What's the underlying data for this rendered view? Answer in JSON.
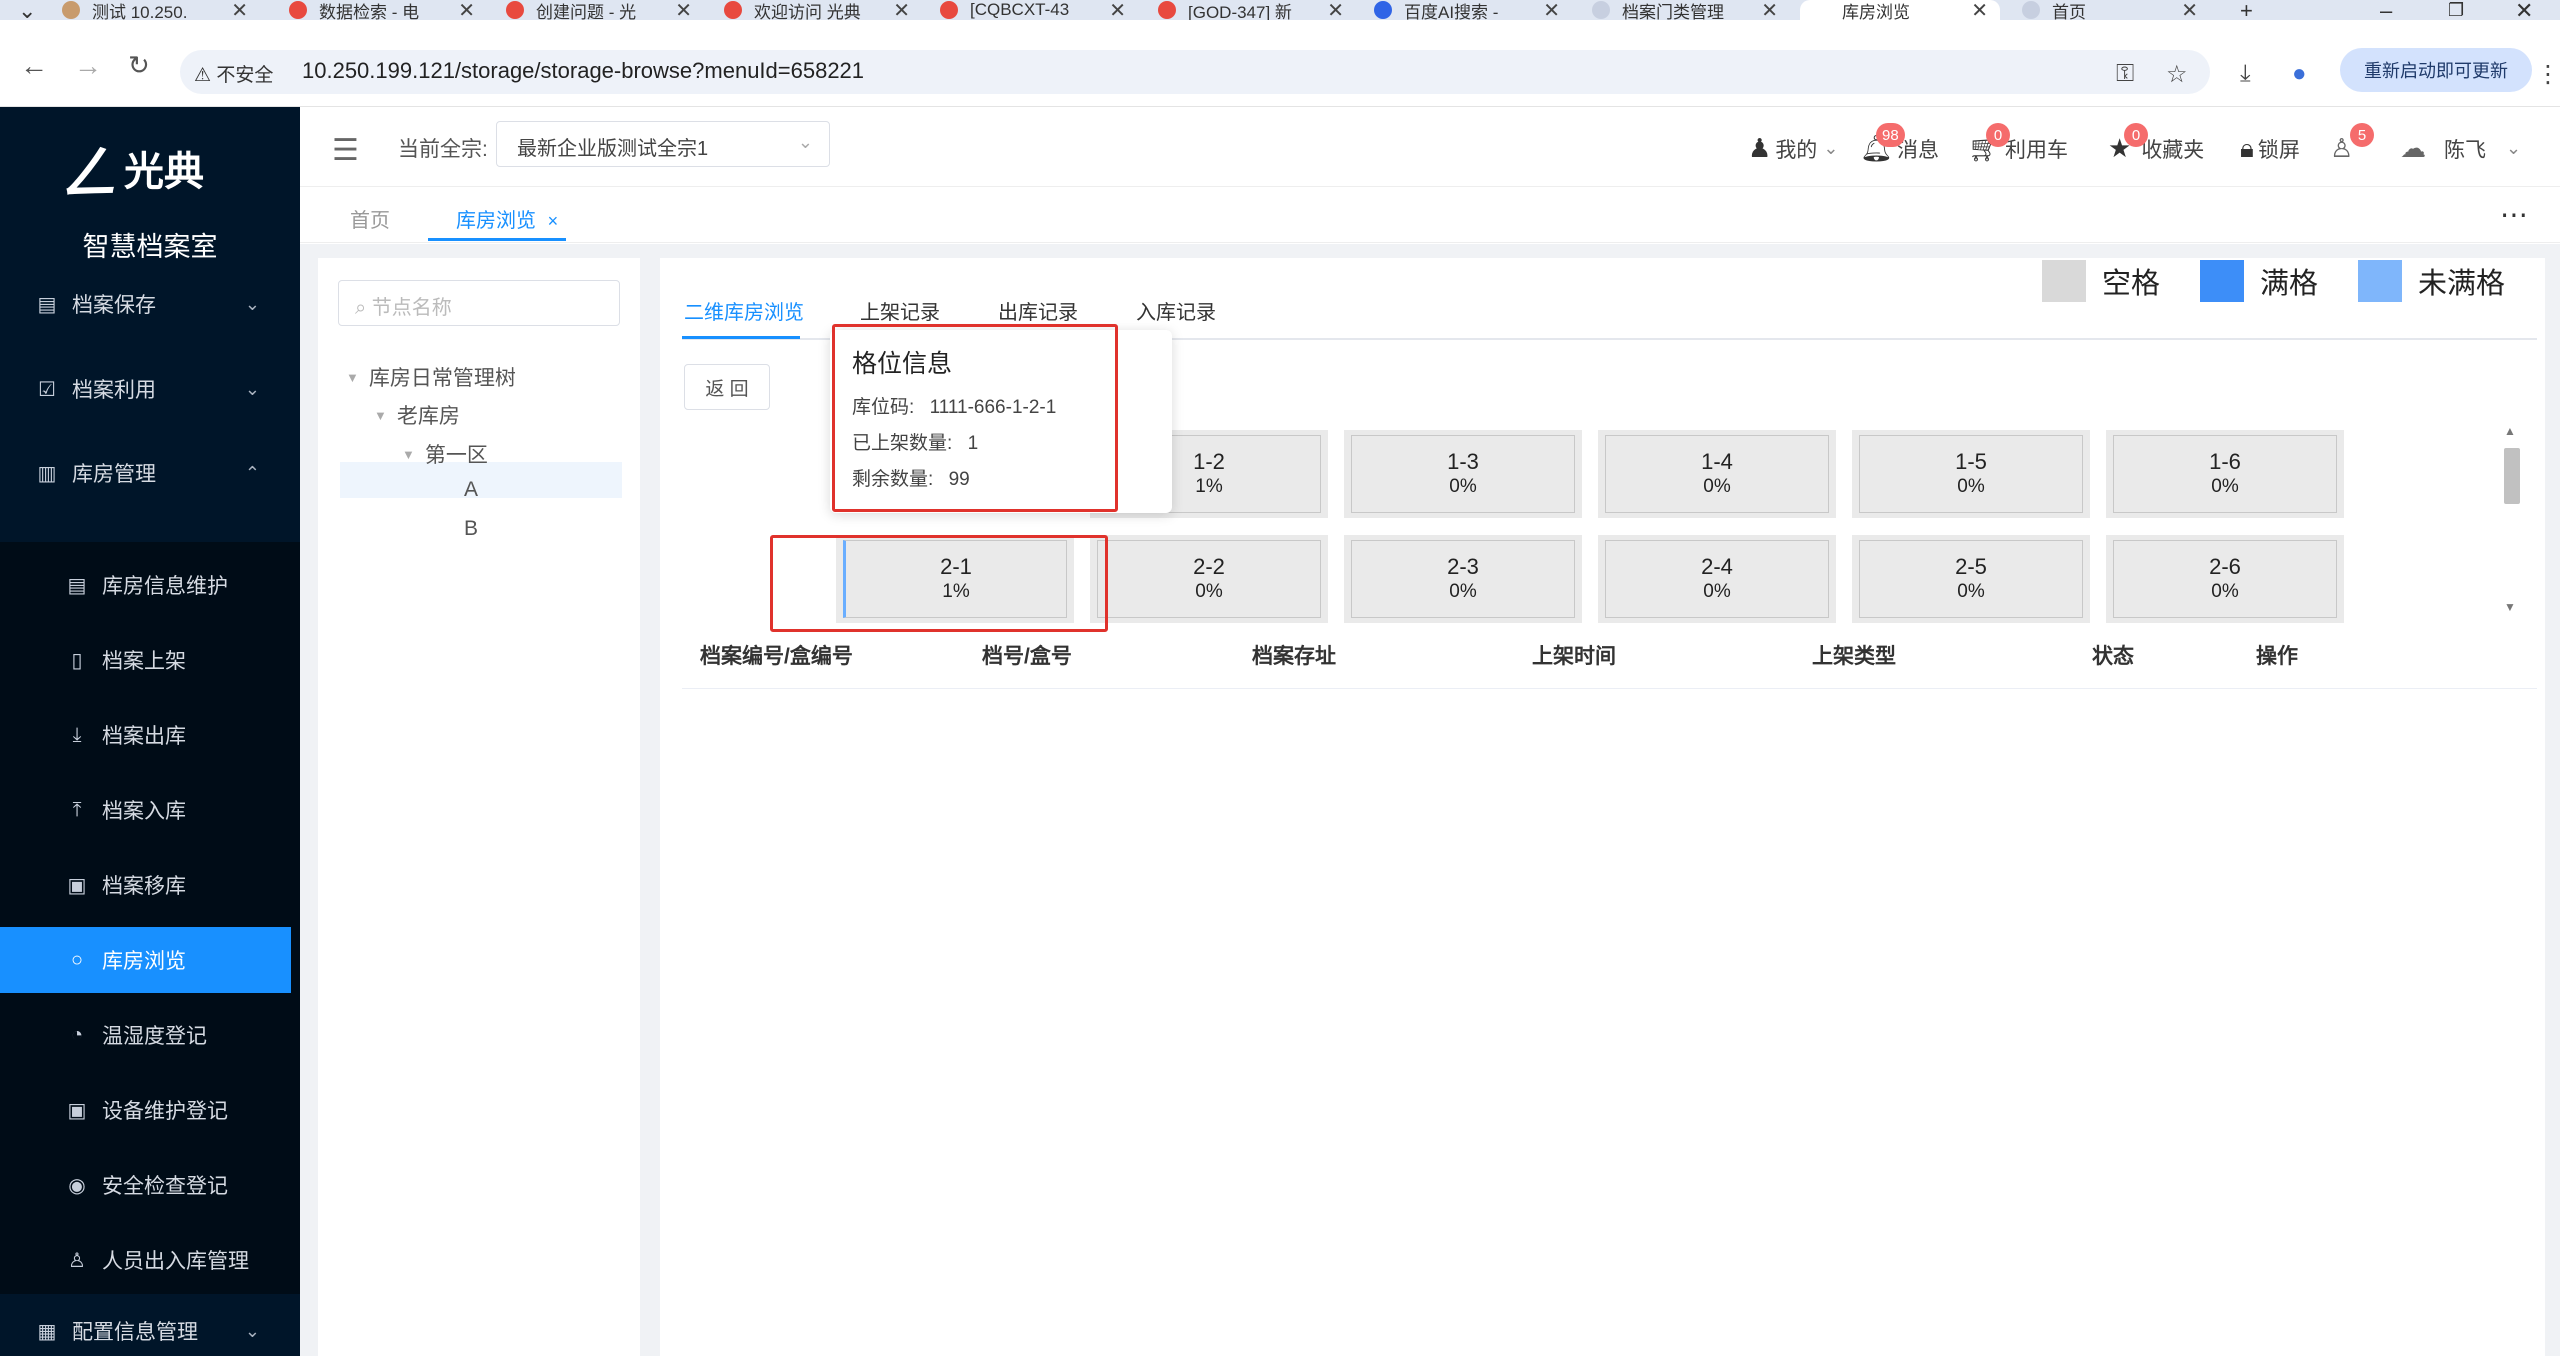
{
  "browser": {
    "tabs": [
      {
        "title": "测试 10.250.",
        "icon_color": "#c89b6d"
      },
      {
        "title": "数据检索 - 电",
        "icon_color": "#e8493f"
      },
      {
        "title": "创建问题 - 光",
        "icon_color": "#e8493f"
      },
      {
        "title": "欢迎访问 光典",
        "icon_color": "#e8493f"
      },
      {
        "title": "[CQBCXT-43",
        "icon_color": "#e8493f"
      },
      {
        "title": "[GOD-347] 新",
        "icon_color": "#e8493f"
      },
      {
        "title": "百度AI搜索 -",
        "icon_color": "#3064e6"
      },
      {
        "title": "档案门类管理",
        "icon_color": "#c7cfe0"
      },
      {
        "title": "库房浏览",
        "icon_color": "#ffffff"
      },
      {
        "title": "首页",
        "icon_color": "#c7cfe0"
      }
    ],
    "security_label": "不安全",
    "url": "10.250.199.121/storage/storage-browse?menuId=658221",
    "restart_label": "重新启动即可更新"
  },
  "sidebar": {
    "logo_text": "光典",
    "app_name": "智慧档案室",
    "items": [
      {
        "label": "档案保存",
        "icon": "building-icon",
        "glyph": "▤",
        "arrow": "⌄"
      },
      {
        "label": "档案利用",
        "icon": "clipboard-icon",
        "glyph": "☑",
        "arrow": "⌄"
      },
      {
        "label": "库房管理",
        "icon": "warehouse-icon",
        "glyph": "▥",
        "arrow": "⌃"
      }
    ],
    "subitems": [
      {
        "label": "库房信息维护",
        "icon": "building-icon",
        "glyph": "▤"
      },
      {
        "label": "档案上架",
        "icon": "box-icon",
        "glyph": "▯"
      },
      {
        "label": "档案出库",
        "icon": "download-icon",
        "glyph": "⤓"
      },
      {
        "label": "档案入库",
        "icon": "upload-icon",
        "glyph": "⤒"
      },
      {
        "label": "档案移库",
        "icon": "transfer-icon",
        "glyph": "▣"
      },
      {
        "label": "库房浏览",
        "icon": "search-icon",
        "glyph": "○"
      },
      {
        "label": "温湿度登记",
        "icon": "gauge-icon",
        "glyph": "◔"
      },
      {
        "label": "设备维护登记",
        "icon": "device-icon",
        "glyph": "▣"
      },
      {
        "label": "安全检查登记",
        "icon": "eye-icon",
        "glyph": "◉"
      },
      {
        "label": "人员出入库管理",
        "icon": "user-icon",
        "glyph": "♙"
      }
    ],
    "bottom_item": {
      "label": "配置信息管理",
      "icon": "config-icon",
      "glyph": "▦",
      "arrow": "⌄"
    }
  },
  "header": {
    "quanzong_label": "当前全宗:",
    "quanzong_value": "最新企业版测试全宗1",
    "mine_label": "我的",
    "message_label": "消息",
    "message_count": "98",
    "cart_label": "利用车",
    "cart_count": "0",
    "favorites_label": "收藏夹",
    "favorites_count": "0",
    "lock_label": "锁屏",
    "user_badge_count": "5",
    "user_name": "陈飞"
  },
  "page_tabs": {
    "home": "首页",
    "current": "库房浏览",
    "close": "×"
  },
  "tree": {
    "placeholder": "节点名称",
    "nodes": [
      {
        "label": "库房日常管理树",
        "toggle": "▼"
      },
      {
        "label": "老库房",
        "toggle": "▼"
      },
      {
        "label": "第一区",
        "toggle": "▼"
      },
      {
        "label": "A",
        "toggle": ""
      },
      {
        "label": "B",
        "toggle": ""
      }
    ]
  },
  "main": {
    "tabs": [
      "二维库房浏览",
      "上架记录",
      "出库记录",
      "入库记录"
    ],
    "legend": [
      {
        "label": "空格",
        "color": "#d9d9d9"
      },
      {
        "label": "满格",
        "color": "#3d8ef8"
      },
      {
        "label": "未满格",
        "color": "#7fb6fb"
      }
    ],
    "back_label": "返 回",
    "rows": [
      [
        {
          "name": "",
          "pct": ""
        },
        {
          "name": "1-2",
          "pct": "1%"
        },
        {
          "name": "1-3",
          "pct": "0%"
        },
        {
          "name": "1-4",
          "pct": "0%"
        },
        {
          "name": "1-5",
          "pct": "0%"
        },
        {
          "name": "1-6",
          "pct": "0%"
        }
      ],
      [
        {
          "name": "2-1",
          "pct": "1%"
        },
        {
          "name": "2-2",
          "pct": "0%"
        },
        {
          "name": "2-3",
          "pct": "0%"
        },
        {
          "name": "2-4",
          "pct": "0%"
        },
        {
          "name": "2-5",
          "pct": "0%"
        },
        {
          "name": "2-6",
          "pct": "0%"
        }
      ]
    ],
    "table_headers": [
      "档案编号/盒编号",
      "档号/盒号",
      "档案存址",
      "上架时间",
      "上架类型",
      "状态",
      "操作"
    ]
  },
  "tooltip": {
    "title": "格位信息",
    "code_label": "库位码:",
    "code_value": "1111-666-1-2-1",
    "shelved_label": "已上架数量:",
    "shelved_value": "1",
    "remaining_label": "剩余数量:",
    "remaining_value": "99"
  }
}
